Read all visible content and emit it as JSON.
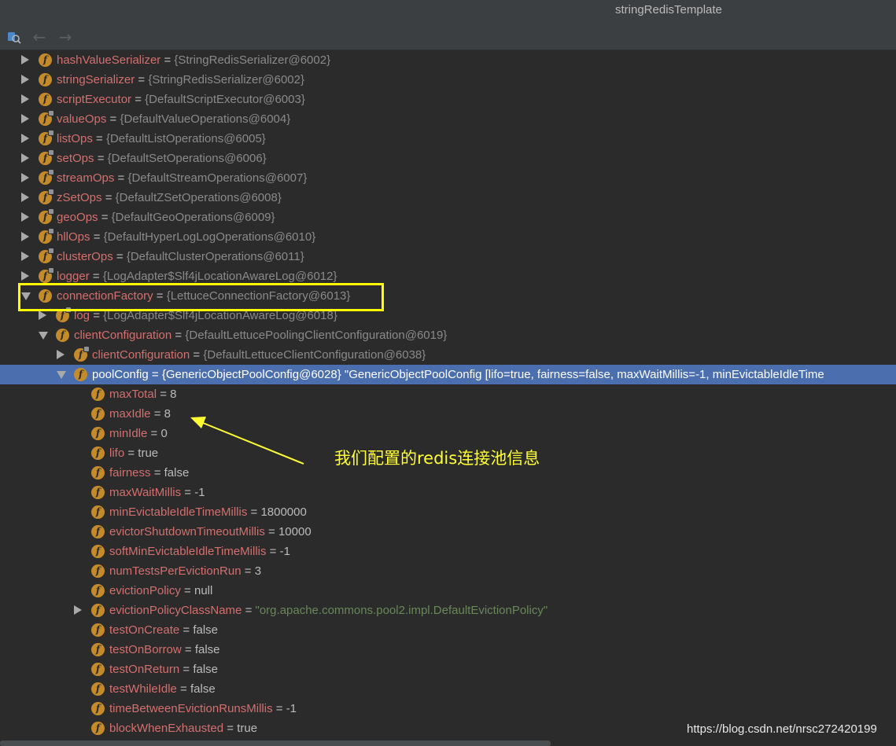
{
  "window": {
    "title": "stringRedisTemplate"
  },
  "toolbar": {
    "variables_icon": "variables-icon",
    "back_icon": "back-arrow-icon",
    "forward_icon": "forward-arrow-icon",
    "back_glyph": "←",
    "forward_glyph": "→"
  },
  "colors": {
    "background": "#2b2b2b",
    "field_name": "#d46f6f",
    "reference_value": "#8a8a8a",
    "string_value": "#6a8759",
    "selection": "#4b6eaf",
    "field_icon": "#c58b2b",
    "annotation": "#ffff33"
  },
  "field_icon_glyph": "f",
  "rows": [
    {
      "name": "hashValueSerializer",
      "value": "{StringRedisSerializer@6002}",
      "kind": "ref",
      "depth": 0,
      "toggle": "closed",
      "locked": false
    },
    {
      "name": "stringSerializer",
      "value": "{StringRedisSerializer@6002}",
      "kind": "ref",
      "depth": 0,
      "toggle": "closed",
      "locked": false
    },
    {
      "name": "scriptExecutor",
      "value": "{DefaultScriptExecutor@6003}",
      "kind": "ref",
      "depth": 0,
      "toggle": "closed",
      "locked": false
    },
    {
      "name": "valueOps",
      "value": "{DefaultValueOperations@6004}",
      "kind": "ref",
      "depth": 0,
      "toggle": "closed",
      "locked": true
    },
    {
      "name": "listOps",
      "value": "{DefaultListOperations@6005}",
      "kind": "ref",
      "depth": 0,
      "toggle": "closed",
      "locked": true
    },
    {
      "name": "setOps",
      "value": "{DefaultSetOperations@6006}",
      "kind": "ref",
      "depth": 0,
      "toggle": "closed",
      "locked": true
    },
    {
      "name": "streamOps",
      "value": "{DefaultStreamOperations@6007}",
      "kind": "ref",
      "depth": 0,
      "toggle": "closed",
      "locked": true
    },
    {
      "name": "zSetOps",
      "value": "{DefaultZSetOperations@6008}",
      "kind": "ref",
      "depth": 0,
      "toggle": "closed",
      "locked": true
    },
    {
      "name": "geoOps",
      "value": "{DefaultGeoOperations@6009}",
      "kind": "ref",
      "depth": 0,
      "toggle": "closed",
      "locked": true
    },
    {
      "name": "hllOps",
      "value": "{DefaultHyperLogLogOperations@6010}",
      "kind": "ref",
      "depth": 0,
      "toggle": "closed",
      "locked": true
    },
    {
      "name": "clusterOps",
      "value": "{DefaultClusterOperations@6011}",
      "kind": "ref",
      "depth": 0,
      "toggle": "closed",
      "locked": true
    },
    {
      "name": "logger",
      "value": "{LogAdapter$Slf4jLocationAwareLog@6012}",
      "kind": "ref",
      "depth": 0,
      "toggle": "closed",
      "locked": true
    },
    {
      "name": "connectionFactory",
      "value": "{LettuceConnectionFactory@6013}",
      "kind": "ref",
      "depth": 0,
      "toggle": "open",
      "locked": false
    },
    {
      "name": "log",
      "value": "{LogAdapter$Slf4jLocationAwareLog@6018}",
      "kind": "ref",
      "depth": 1,
      "toggle": "closed",
      "locked": true
    },
    {
      "name": "clientConfiguration",
      "value": "{DefaultLettucePoolingClientConfiguration@6019}",
      "kind": "ref",
      "depth": 1,
      "toggle": "open",
      "locked": false
    },
    {
      "name": "clientConfiguration",
      "value": "{DefaultLettuceClientConfiguration@6038}",
      "kind": "ref",
      "depth": 2,
      "toggle": "closed",
      "locked": true
    },
    {
      "name": "poolConfig",
      "value": "{GenericObjectPoolConfig@6028} \"GenericObjectPoolConfig [lifo=true, fairness=false, maxWaitMillis=-1, minEvictableIdleTime",
      "kind": "ref",
      "depth": 2,
      "toggle": "open",
      "locked": false,
      "selected": true
    },
    {
      "name": "maxTotal",
      "value": "8",
      "kind": "prim",
      "depth": 3,
      "toggle": "none",
      "locked": false
    },
    {
      "name": "maxIdle",
      "value": "8",
      "kind": "prim",
      "depth": 3,
      "toggle": "none",
      "locked": false
    },
    {
      "name": "minIdle",
      "value": "0",
      "kind": "prim",
      "depth": 3,
      "toggle": "none",
      "locked": false
    },
    {
      "name": "lifo",
      "value": "true",
      "kind": "prim",
      "depth": 3,
      "toggle": "none",
      "locked": false
    },
    {
      "name": "fairness",
      "value": "false",
      "kind": "prim",
      "depth": 3,
      "toggle": "none",
      "locked": false
    },
    {
      "name": "maxWaitMillis",
      "value": "-1",
      "kind": "prim",
      "depth": 3,
      "toggle": "none",
      "locked": false
    },
    {
      "name": "minEvictableIdleTimeMillis",
      "value": "1800000",
      "kind": "prim",
      "depth": 3,
      "toggle": "none",
      "locked": false
    },
    {
      "name": "evictorShutdownTimeoutMillis",
      "value": "10000",
      "kind": "prim",
      "depth": 3,
      "toggle": "none",
      "locked": false
    },
    {
      "name": "softMinEvictableIdleTimeMillis",
      "value": "-1",
      "kind": "prim",
      "depth": 3,
      "toggle": "none",
      "locked": false
    },
    {
      "name": "numTestsPerEvictionRun",
      "value": "3",
      "kind": "prim",
      "depth": 3,
      "toggle": "none",
      "locked": false
    },
    {
      "name": "evictionPolicy",
      "value": "null",
      "kind": "prim",
      "depth": 3,
      "toggle": "none",
      "locked": false
    },
    {
      "name": "evictionPolicyClassName",
      "value": "\"org.apache.commons.pool2.impl.DefaultEvictionPolicy\"",
      "kind": "str",
      "depth": 3,
      "toggle": "closed",
      "locked": false
    },
    {
      "name": "testOnCreate",
      "value": "false",
      "kind": "prim",
      "depth": 3,
      "toggle": "none",
      "locked": false
    },
    {
      "name": "testOnBorrow",
      "value": "false",
      "kind": "prim",
      "depth": 3,
      "toggle": "none",
      "locked": false
    },
    {
      "name": "testOnReturn",
      "value": "false",
      "kind": "prim",
      "depth": 3,
      "toggle": "none",
      "locked": false
    },
    {
      "name": "testWhileIdle",
      "value": "false",
      "kind": "prim",
      "depth": 3,
      "toggle": "none",
      "locked": false
    },
    {
      "name": "timeBetweenEvictionRunsMillis",
      "value": "-1",
      "kind": "prim",
      "depth": 3,
      "toggle": "none",
      "locked": false
    },
    {
      "name": "blockWhenExhausted",
      "value": "true",
      "kind": "prim",
      "depth": 3,
      "toggle": "none",
      "locked": false
    }
  ],
  "annotation": {
    "text": "我们配置的redis连接池信息"
  },
  "watermark": {
    "text": "https://blog.csdn.net/nrsc272420199"
  }
}
